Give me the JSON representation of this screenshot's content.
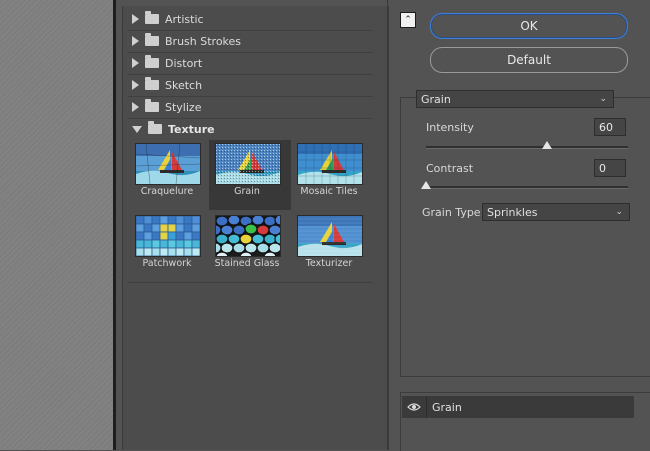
{
  "filter_gallery": {
    "categories": [
      {
        "label": "Artistic",
        "expanded": false
      },
      {
        "label": "Brush Strokes",
        "expanded": false
      },
      {
        "label": "Distort",
        "expanded": false
      },
      {
        "label": "Sketch",
        "expanded": false
      },
      {
        "label": "Stylize",
        "expanded": false
      },
      {
        "label": "Texture",
        "expanded": true
      }
    ],
    "texture_filters": [
      {
        "label": "Craquelure",
        "icon": "craquelure-thumbnail",
        "selected": false
      },
      {
        "label": "Grain",
        "icon": "grain-thumbnail",
        "selected": true
      },
      {
        "label": "Mosaic Tiles",
        "icon": "mosaic-tiles-thumbnail",
        "selected": false
      },
      {
        "label": "Patchwork",
        "icon": "patchwork-thumbnail",
        "selected": false
      },
      {
        "label": "Stained Glass",
        "icon": "stained-glass-thumbnail",
        "selected": false
      },
      {
        "label": "Texturizer",
        "icon": "texturizer-thumbnail",
        "selected": false
      }
    ]
  },
  "buttons": {
    "ok": "OK",
    "default": "Default"
  },
  "settings": {
    "filter_select": "Grain",
    "intensity": {
      "label": "Intensity",
      "value": "60",
      "fraction": 0.6
    },
    "contrast": {
      "label": "Contrast",
      "value": "0",
      "fraction": 0.0
    },
    "grain_type": {
      "label": "Grain Type:",
      "value": "Sprinkles"
    }
  },
  "layers": [
    {
      "name": "Grain",
      "visible": true,
      "icon": "eye-icon"
    }
  ],
  "colors": {
    "accent": "#3d7fd9",
    "panel": "#535353",
    "selected_cell": "#383838"
  }
}
